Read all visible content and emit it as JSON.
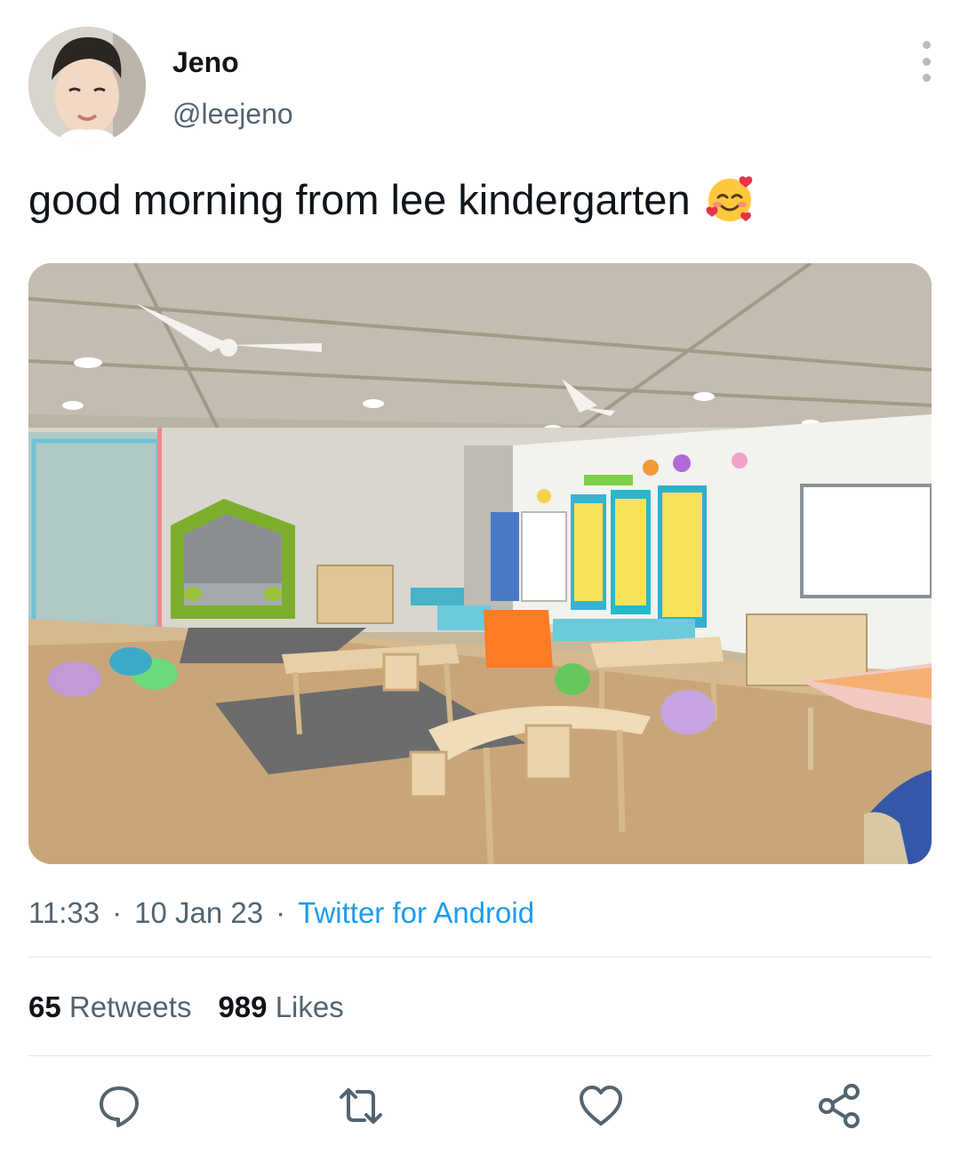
{
  "tweet": {
    "author": {
      "display_name": "Jeno",
      "handle": "@leejeno"
    },
    "text": "good morning from lee kindergarten",
    "emoji_icon": "smiling-face-with-hearts-icon",
    "meta": {
      "time": "11:33",
      "separator": "·",
      "date": "10 Jan 23",
      "source": "Twitter for Android"
    },
    "stats": {
      "retweets_count": "65",
      "retweets_label": "Retweets",
      "likes_count": "989",
      "likes_label": "Likes"
    },
    "actions": [
      "reply-icon",
      "retweet-icon",
      "like-icon",
      "share-icon"
    ]
  },
  "colors": {
    "link": "#1d9bf0",
    "secondary_text": "#536471",
    "primary_text": "#0f1419"
  }
}
